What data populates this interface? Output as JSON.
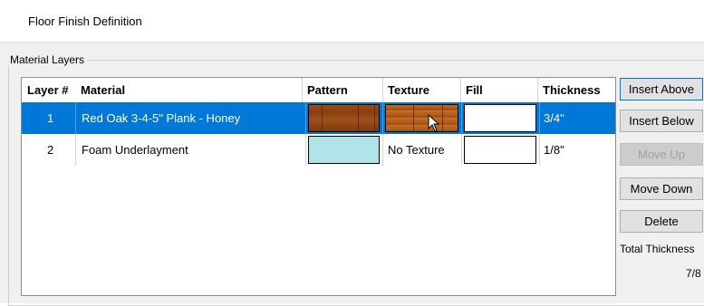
{
  "window": {
    "title": "Floor Finish Definition"
  },
  "group": {
    "label": "Material Layers"
  },
  "table": {
    "columns": [
      "Layer #",
      "Material",
      "Pattern",
      "Texture",
      "Fill",
      "Thickness"
    ],
    "rows": [
      {
        "layer": "1",
        "material": "Red Oak 3-4-5\" Plank - Honey",
        "pattern": "wood-plank",
        "texture": "wood-texture",
        "fill": "#ffffff",
        "thickness": "3/4\"",
        "selected": true
      },
      {
        "layer": "2",
        "material": "Foam Underlayment",
        "pattern_color": "#b0e4e8",
        "texture": "No Texture",
        "fill": "#ffffff",
        "thickness": "1/8\"",
        "selected": false
      }
    ]
  },
  "buttons": {
    "insert_above": "Insert Above",
    "insert_below": "Insert Below",
    "move_up": "Move Up",
    "move_down": "Move Down",
    "delete": "Delete"
  },
  "total": {
    "label": "Total Thickness",
    "value": "7/8"
  },
  "colors": {
    "selection": "#0078d7",
    "foam": "#b0e4e8"
  }
}
